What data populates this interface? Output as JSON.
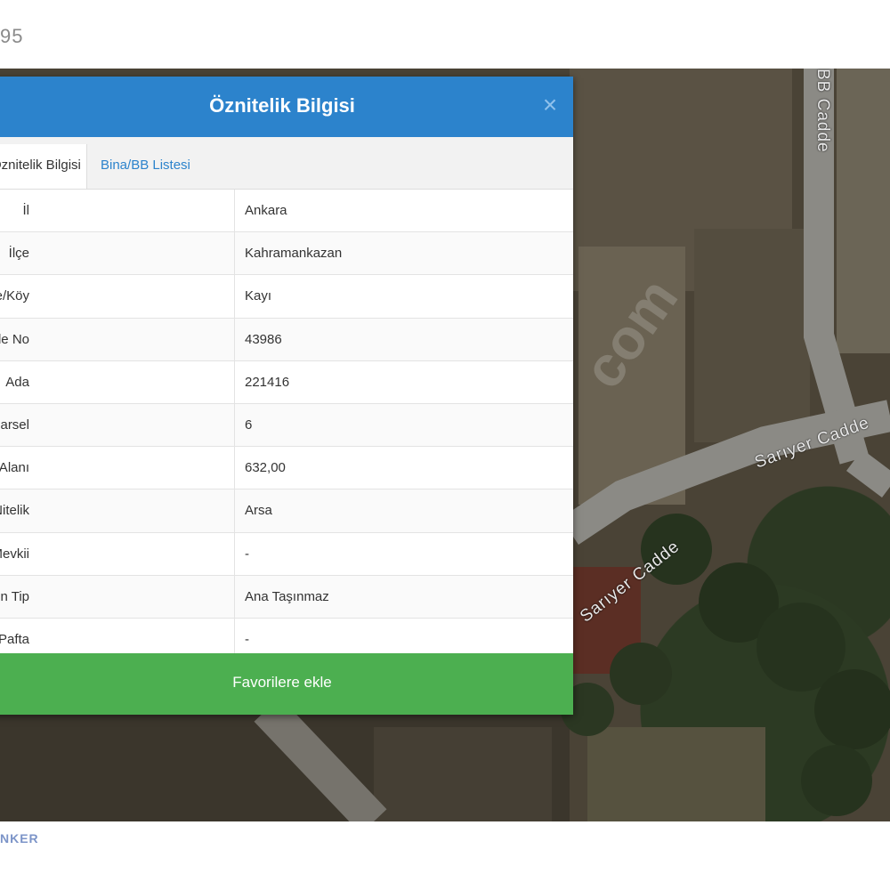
{
  "page": {
    "top_number": "95",
    "bottom_link": "NKER"
  },
  "map": {
    "roads": {
      "north": "BB Cadde",
      "sariyer_1": "Sarıyer Cadde",
      "sariyer_2": "Sarıyer Cadde"
    },
    "watermark": "com"
  },
  "modal": {
    "title": "Öznitelik Bilgisi",
    "close_symbol": "×",
    "tabs": [
      {
        "label": "Öznitelik Bilgisi",
        "active": true
      },
      {
        "label": "Bina/BB Listesi",
        "active": false
      }
    ],
    "rows": [
      {
        "label": "İl",
        "value": "Ankara"
      },
      {
        "label": "İlçe",
        "value": "Kahramankazan"
      },
      {
        "label": "Mahalle/Köy",
        "value": "Kayı"
      },
      {
        "label": "Mahalle No",
        "value": "43986"
      },
      {
        "label": "Ada",
        "value": "221416"
      },
      {
        "label": "Parsel",
        "value": "6"
      },
      {
        "label": "Taşınmaz Alanı",
        "value": "632,00"
      },
      {
        "label": "Nitelik",
        "value": "Arsa"
      },
      {
        "label": "Mevkii",
        "value": "-"
      },
      {
        "label": "Zemin Tip",
        "value": "Ana Taşınmaz"
      },
      {
        "label": "Pafta",
        "value": "-"
      }
    ],
    "favorite_button": "Favorilere ekle"
  },
  "colors": {
    "header": "#2c83cc",
    "button": "#4caf50",
    "link": "#2c83cc"
  }
}
